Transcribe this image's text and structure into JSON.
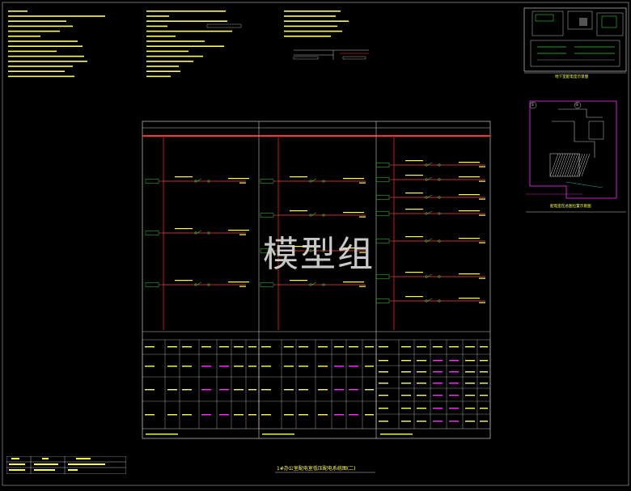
{
  "drawing": {
    "watermark": "模型组",
    "bottom_title": "1#办公室配电室低压配电系统图(二)",
    "site_caption_top": "地下室配电室示意图",
    "site_caption_bottom": "配电室在总图位置示意图",
    "markers": [
      "①",
      "②"
    ]
  },
  "colors": {
    "background": "#000000",
    "frame": "#c8c8c8",
    "busbar": "#ff3030",
    "feeder": "#ff4040",
    "breaker": "#40ff40",
    "label_box": "#30d030",
    "note_text": "#ffff55",
    "magenta": "#ff30ff",
    "cyan": "#30e0e0"
  }
}
